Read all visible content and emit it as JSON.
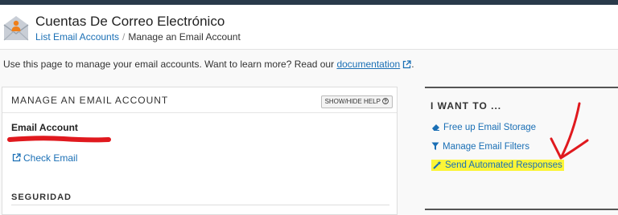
{
  "header": {
    "title": "Cuentas De Correo Electrónico",
    "breadcrumb": {
      "link": "List Email Accounts",
      "separator": "/",
      "current": "Manage an Email Account"
    }
  },
  "intro": {
    "text": "Use this page to manage your email accounts. Want to learn more? Read our",
    "link": "documentation",
    "end": "."
  },
  "panel": {
    "title": "MANAGE AN EMAIL ACCOUNT",
    "help_button": "SHOW/HIDE HELP",
    "email_label": "Email Account",
    "check_email": "Check Email",
    "section": "SEGURIDAD"
  },
  "sidebar": {
    "title": "I WANT TO ...",
    "items": [
      {
        "label": "Free up Email Storage",
        "icon": "eraser-icon"
      },
      {
        "label": "Manage Email Filters",
        "icon": "filter-icon"
      },
      {
        "label": "Send Automated Responses",
        "icon": "magic-wand-icon"
      }
    ]
  },
  "colors": {
    "link": "#1a6fb5",
    "topbar": "#293a4a",
    "highlight": "#fbf537",
    "annotation": "#e0191e"
  }
}
